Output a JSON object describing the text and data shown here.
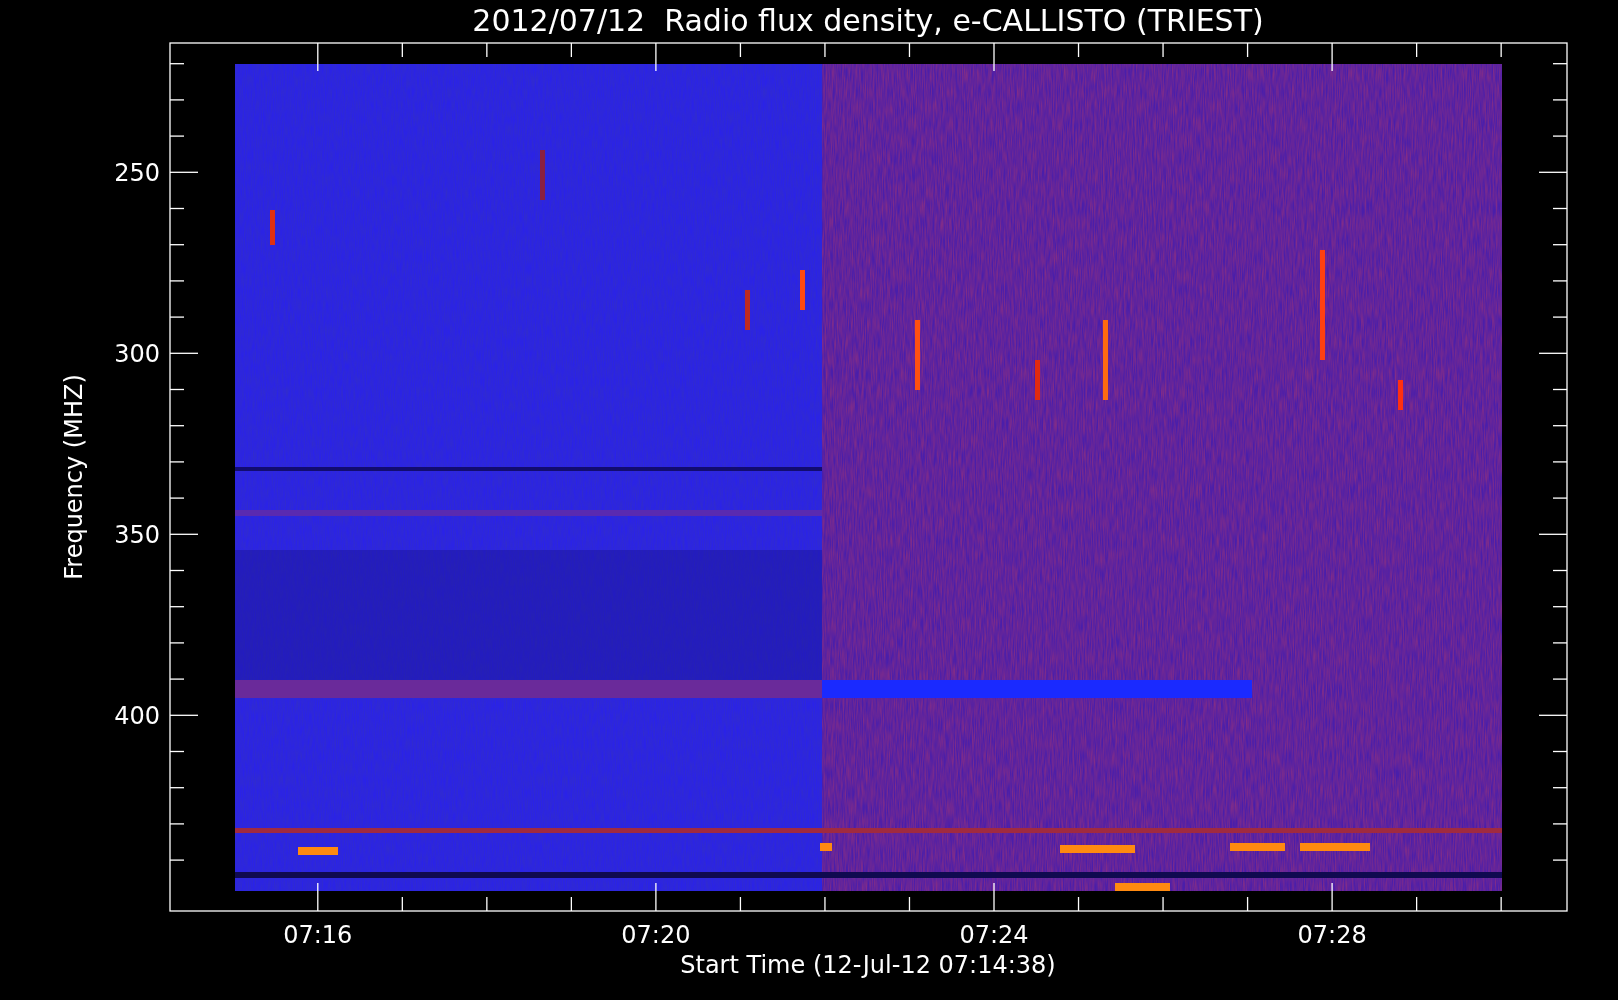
{
  "title": "2012/07/12  Radio flux density, e-CALLISTO (TRIEST)",
  "y_axis": {
    "label": "Frequency (MHZ)",
    "ticks": [
      "250",
      "300",
      "350",
      "400"
    ]
  },
  "x_axis": {
    "label": "Start Time (12-Jul-12 07:14:38)",
    "ticks": [
      "07:16",
      "07:20",
      "07:24",
      "07:28"
    ]
  }
}
